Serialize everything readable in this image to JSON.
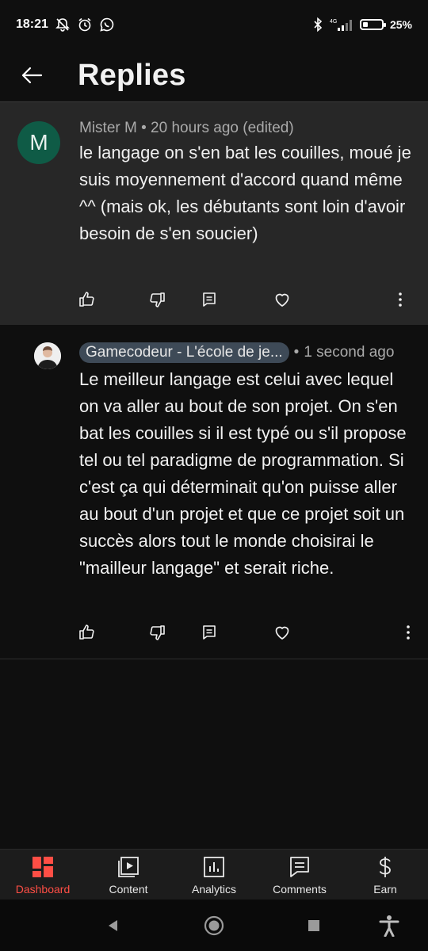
{
  "status_bar": {
    "time": "18:21",
    "battery_percent": "25%",
    "battery_level": 0.25,
    "network_label": "4G"
  },
  "header": {
    "title": "Replies"
  },
  "parent_comment": {
    "avatar_letter": "M",
    "author": "Mister M",
    "separator": "•",
    "time": "20 hours ago (edited)",
    "text": "le langage on s'en bat les couilles, moué je suis moyennement d'accord quand même ^^  (mais ok, les débutants sont loin d'avoir besoin de s'en soucier)"
  },
  "reply": {
    "author": "Gamecodeur - L'école de je...",
    "separator": "•",
    "time": "1 second ago",
    "text": "Le meilleur langage est celui avec lequel on va aller au bout de son projet. On s'en bat les couilles si il est typé ou s'il propose tel ou tel paradigme de programmation. Si c'est ça qui déterminait qu'on puisse aller au bout d'un projet et que ce projet soit un succès alors tout le monde choisirai le \"mailleur langage\" et serait riche."
  },
  "bottom_nav": {
    "items": [
      {
        "label": "Dashboard",
        "icon": "dashboard-icon",
        "active": true
      },
      {
        "label": "Content",
        "icon": "content-icon",
        "active": false
      },
      {
        "label": "Analytics",
        "icon": "analytics-icon",
        "active": false
      },
      {
        "label": "Comments",
        "icon": "comments-icon",
        "active": false
      },
      {
        "label": "Earn",
        "icon": "earn-icon",
        "active": false
      }
    ]
  },
  "colors": {
    "accent": "#ff4e45",
    "parent_bg": "#272727",
    "page_bg": "#0f0f0f",
    "avatar_m": "#0f5b46",
    "chip": "#3e4a57"
  }
}
